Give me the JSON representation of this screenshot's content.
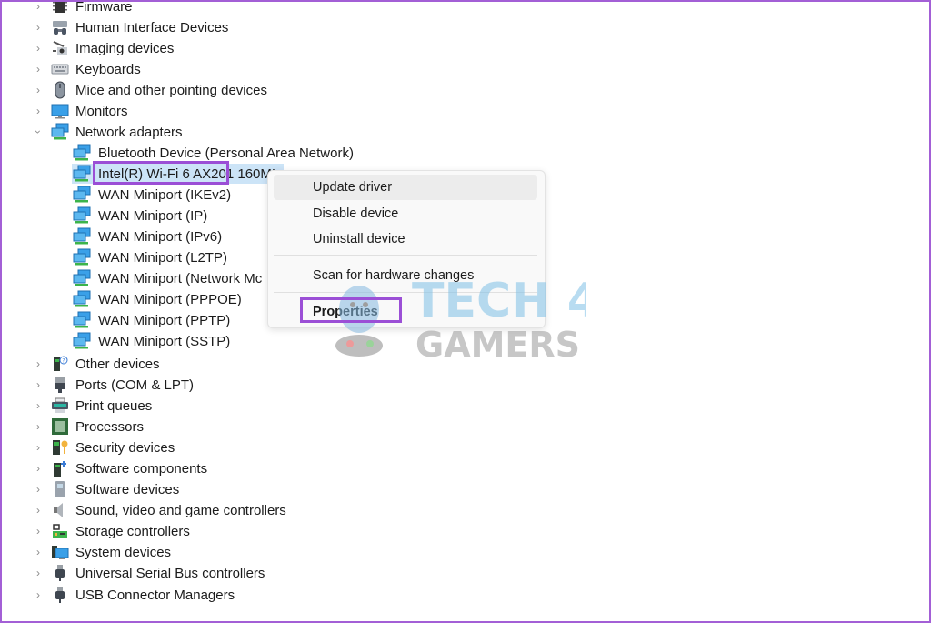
{
  "device_tree": {
    "categories_top": [
      {
        "label": "Firmware",
        "icon": "firmware-chip-icon",
        "expanded": false
      },
      {
        "label": "Human Interface Devices",
        "icon": "hid-icon",
        "expanded": false
      },
      {
        "label": "Imaging devices",
        "icon": "camera-icon",
        "expanded": false
      },
      {
        "label": "Keyboards",
        "icon": "keyboard-icon",
        "expanded": false
      },
      {
        "label": "Mice and other pointing devices",
        "icon": "mouse-icon",
        "expanded": false
      },
      {
        "label": "Monitors",
        "icon": "monitor-icon",
        "expanded": false
      },
      {
        "label": "Network adapters",
        "icon": "network-icon",
        "expanded": true
      }
    ],
    "network_children": [
      {
        "label": "Bluetooth Device (Personal Area Network)"
      },
      {
        "label": "Intel(R) Wi-Fi 6 AX201 160MHz",
        "visible_label": "Intel(R) Wi-Fi 6 AX201 160MI",
        "selected": true
      },
      {
        "label": "WAN Miniport (IKEv2)"
      },
      {
        "label": "WAN Miniport (IP)"
      },
      {
        "label": "WAN Miniport (IPv6)"
      },
      {
        "label": "WAN Miniport (L2TP)"
      },
      {
        "label": "WAN Miniport (Network Mc"
      },
      {
        "label": "WAN Miniport (PPPOE)"
      },
      {
        "label": "WAN Miniport (PPTP)"
      },
      {
        "label": "WAN Miniport (SSTP)"
      }
    ],
    "categories_bottom": [
      {
        "label": "Other devices",
        "icon": "other-devices-icon"
      },
      {
        "label": "Ports (COM & LPT)",
        "icon": "port-icon"
      },
      {
        "label": "Print queues",
        "icon": "printer-icon"
      },
      {
        "label": "Processors",
        "icon": "processor-icon"
      },
      {
        "label": "Security devices",
        "icon": "security-key-icon"
      },
      {
        "label": "Software components",
        "icon": "software-component-icon"
      },
      {
        "label": "Software devices",
        "icon": "software-device-icon"
      },
      {
        "label": "Sound, video and game controllers",
        "icon": "speaker-icon"
      },
      {
        "label": "Storage controllers",
        "icon": "storage-icon"
      },
      {
        "label": "System devices",
        "icon": "system-devices-icon"
      },
      {
        "label": "Universal Serial Bus controllers",
        "icon": "usb-icon"
      },
      {
        "label": "USB Connector Managers",
        "icon": "usb-connector-icon"
      }
    ]
  },
  "context_menu": {
    "items": [
      {
        "label": "Update driver",
        "hovered": true
      },
      {
        "label": "Disable device"
      },
      {
        "label": "Uninstall device"
      },
      {
        "label": "Scan for hardware changes"
      },
      {
        "label": "Properties",
        "bold": true,
        "highlighted": true
      }
    ]
  },
  "watermark": {
    "line1": "TECH 4",
    "line2": "GAMERS"
  },
  "colors": {
    "highlight_border": "#9b4fd6",
    "selection_bg": "#cce4f7",
    "frame": "#a35fd6"
  }
}
